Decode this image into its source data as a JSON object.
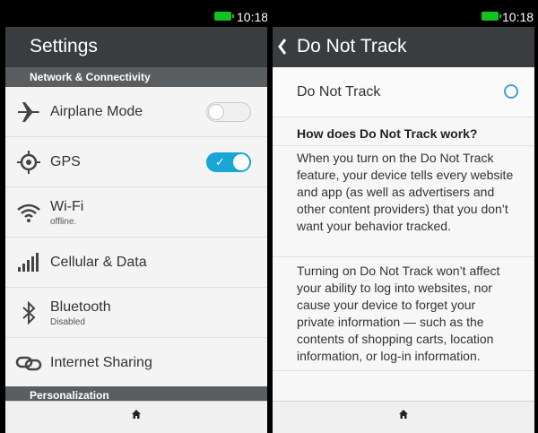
{
  "status": {
    "time": "10:18"
  },
  "settings": {
    "title": "Settings",
    "section_network": "Network & Connectivity",
    "section_personalization": "Personalization",
    "rows": [
      {
        "label": "Airplane Mode",
        "toggle": "off"
      },
      {
        "label": "GPS",
        "toggle": "on"
      },
      {
        "label": "Wi-Fi",
        "sub": "offline."
      },
      {
        "label": "Cellular & Data"
      },
      {
        "label": "Bluetooth",
        "sub": "Disabled"
      },
      {
        "label": "Internet Sharing"
      }
    ],
    "icons": [
      "airplane-icon",
      "gps-icon",
      "wifi-icon",
      "signal-icon",
      "bluetooth-icon",
      "link-icon"
    ]
  },
  "dnt": {
    "title": "Do Not Track",
    "option_label": "Do Not Track",
    "selected": false,
    "question": "How does Do Not Track work?",
    "para1": "When you turn on the Do Not Track feature, your device tells every website and app (as well as advertisers and other content providers) that you don’t want your behavior tracked.",
    "para2": "Turning on Do Not Track won’t affect your ability to log into websites, nor cause your device to forget your private information — such as the contents of shopping carts, location information, or log-in information."
  },
  "colors": {
    "accent": "#19a5d6",
    "header": "#3a3d3f",
    "section": "#5a5e61",
    "battery": "#12c21e"
  }
}
